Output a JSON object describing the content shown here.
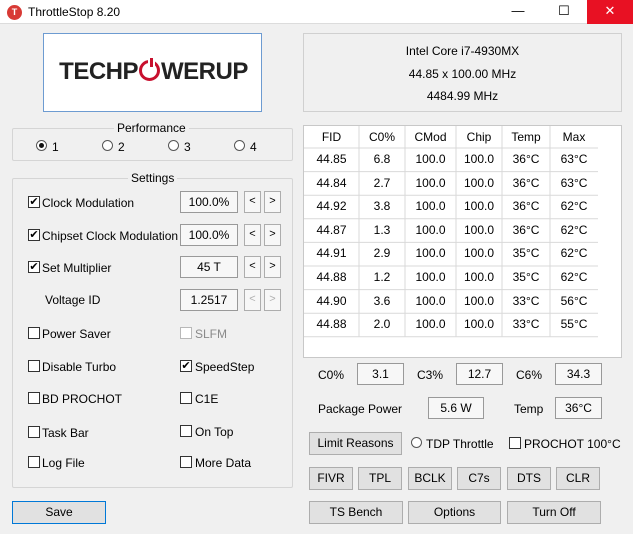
{
  "window": {
    "title": "ThrottleStop 8.20",
    "app_icon": "T",
    "min": "—",
    "max": "☐",
    "close": "✕"
  },
  "logo": {
    "part1": "TECHP",
    "part2": "WERUP"
  },
  "cpu": {
    "name": "Intel Core i7-4930MX",
    "multiplier": "44.85 x 100.00 MHz",
    "freq": "4484.99 MHz"
  },
  "performance": {
    "title": "Performance",
    "profiles": [
      "1",
      "2",
      "3",
      "4"
    ],
    "selected": 0
  },
  "settings": {
    "title": "Settings",
    "clock_mod": {
      "label": "Clock Modulation",
      "value": "100.0%"
    },
    "chipset_mod": {
      "label": "Chipset Clock Modulation",
      "value": "100.0%"
    },
    "set_mult": {
      "label": "Set Multiplier",
      "value": "45 T"
    },
    "voltage": {
      "label": "Voltage ID",
      "value": "1.2517"
    },
    "arrow_left": "<",
    "arrow_right": ">",
    "power_saver": "Power Saver",
    "slfm": "SLFM",
    "disable_turbo": "Disable Turbo",
    "speedstep": "SpeedStep",
    "bd_prochot": "BD PROCHOT",
    "c1e": "C1E",
    "task_bar": "Task Bar",
    "on_top": "On Top",
    "log_file": "Log File",
    "more_data": "More Data"
  },
  "table": {
    "headers": [
      "FID",
      "C0%",
      "CMod",
      "Chip",
      "Temp",
      "Max"
    ],
    "rows": [
      [
        "44.85",
        "6.8",
        "100.0",
        "100.0",
        "36°C",
        "63°C"
      ],
      [
        "44.84",
        "2.7",
        "100.0",
        "100.0",
        "36°C",
        "63°C"
      ],
      [
        "44.92",
        "3.8",
        "100.0",
        "100.0",
        "36°C",
        "62°C"
      ],
      [
        "44.87",
        "1.3",
        "100.0",
        "100.0",
        "36°C",
        "62°C"
      ],
      [
        "44.91",
        "2.9",
        "100.0",
        "100.0",
        "35°C",
        "62°C"
      ],
      [
        "44.88",
        "1.2",
        "100.0",
        "100.0",
        "35°C",
        "62°C"
      ],
      [
        "44.90",
        "3.6",
        "100.0",
        "100.0",
        "33°C",
        "56°C"
      ],
      [
        "44.88",
        "2.0",
        "100.0",
        "100.0",
        "33°C",
        "55°C"
      ]
    ]
  },
  "stats": {
    "c0_label": "C0%",
    "c0": "3.1",
    "c3_label": "C3%",
    "c3": "12.7",
    "c6_label": "C6%",
    "c6": "34.3",
    "pkg_label": "Package Power",
    "pkg": "5.6 W",
    "temp_label": "Temp",
    "temp": "36°C"
  },
  "buttons": {
    "limit_reasons": "Limit Reasons",
    "tdp_throttle": "TDP Throttle",
    "prochot": "PROCHOT 100°C",
    "fivr": "FIVR",
    "tpl": "TPL",
    "bclk": "BCLK",
    "c7s": "C7s",
    "dts": "DTS",
    "clr": "CLR",
    "save": "Save",
    "ts_bench": "TS Bench",
    "options": "Options",
    "turn_off": "Turn Off"
  }
}
